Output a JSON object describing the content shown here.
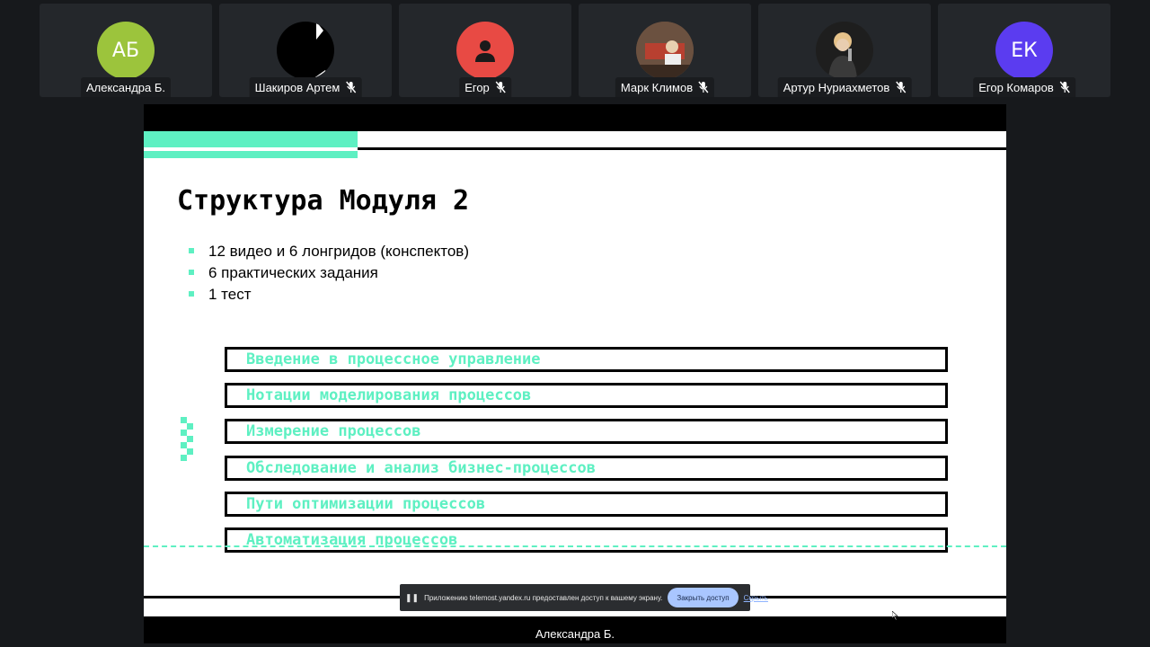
{
  "participants": [
    {
      "name": "Александра Б.",
      "initials": "АБ",
      "avatar_color": "#9cc43c",
      "muted": false,
      "avatar": "initials"
    },
    {
      "name": "Шакиров Артем",
      "initials": "",
      "avatar_color": "#000000",
      "muted": true,
      "avatar": "photo"
    },
    {
      "name": "Егор",
      "initials": "",
      "avatar_color": "#e84a44",
      "muted": true,
      "avatar": "person-icon"
    },
    {
      "name": "Марк Климов",
      "initials": "",
      "avatar_color": "#5a4030",
      "muted": true,
      "avatar": "photo"
    },
    {
      "name": "Артур Нуриахметов",
      "initials": "",
      "avatar_color": "#2a2a2a",
      "muted": true,
      "avatar": "photo"
    },
    {
      "name": "Егор Комаров",
      "initials": "ЕК",
      "avatar_color": "#5b3cf0",
      "muted": true,
      "avatar": "initials"
    }
  ],
  "slide": {
    "title": "Структура Модуля 2",
    "bullets": [
      "12 видео и 6 лонгридов (конспектов)",
      "6 практических задания",
      "1 тест"
    ],
    "modules": [
      "Введение в процессное управление",
      "Нотации моделирования процессов",
      "Измерение процессов",
      "Обследование и анализ бизнес-процессов",
      "Пути оптимизации процессов",
      "Автоматизация процессов"
    ],
    "accent_color": "#5ef0c2"
  },
  "share_notice": {
    "message": "Приложению telemost.yandex.ru предоставлен доступ к вашему экрану.",
    "stop_label": "Закрыть доступ",
    "hide_label": "Скрыть"
  },
  "presenter_name": "Александра Б."
}
